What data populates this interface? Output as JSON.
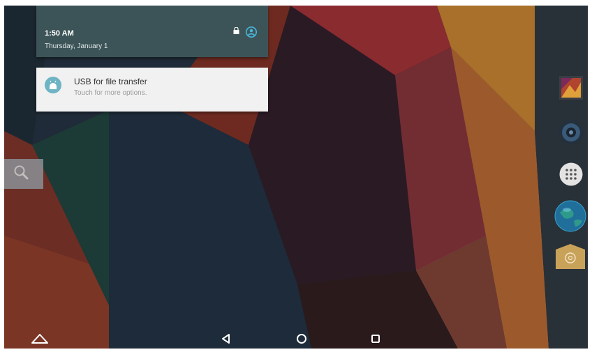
{
  "status": {
    "time": "1:50 AM",
    "date": "Thursday, January 1",
    "icons": [
      "lock-icon",
      "user-icon"
    ]
  },
  "notification": {
    "title": "USB for file transfer",
    "subtitle": "Touch for more options.",
    "icon": "android-icon"
  },
  "dock": [
    "gallery-icon",
    "speaker-icon",
    "apps-grid-icon",
    "globe-icon",
    "contacts-icon"
  ],
  "navigation": [
    "home-up-icon",
    "back-icon",
    "home-icon",
    "recents-icon"
  ],
  "colors": {
    "shade_header": "#3c5458",
    "notification_bg": "#f1f1f1",
    "accent": "#49b7d9"
  }
}
